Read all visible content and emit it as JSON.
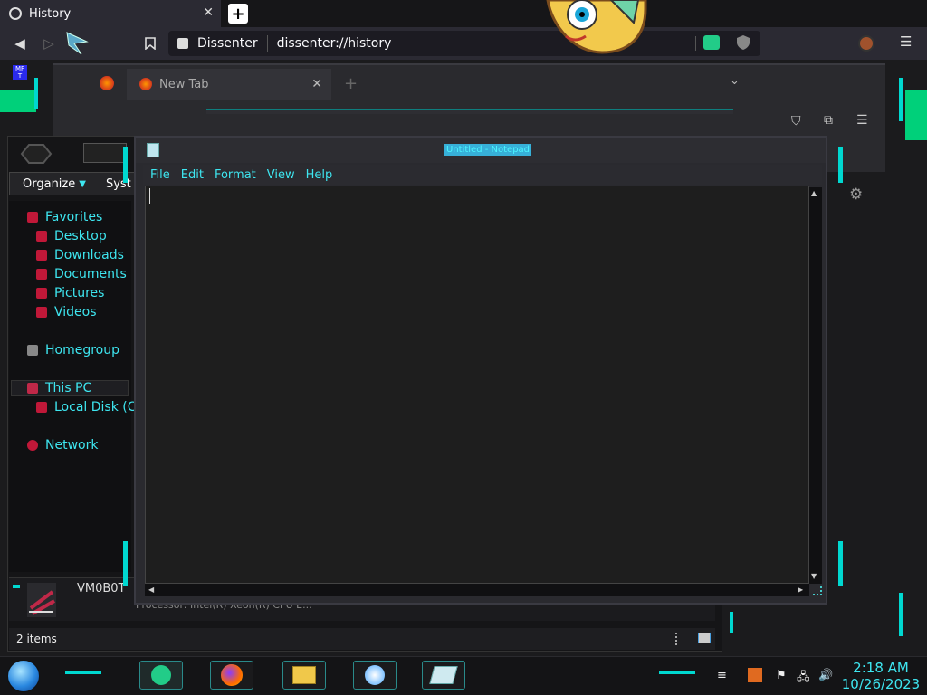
{
  "browser": {
    "tab_title": "History",
    "tab_close": "✕",
    "new_tab": "+",
    "site_name": "Dissenter",
    "url": "dissenter://history"
  },
  "back_browser": {
    "tab_title": "New Tab"
  },
  "explorer": {
    "toolbar_organize": "Organize",
    "toolbar_system": "Syst",
    "nav": {
      "favorites": "Favorites",
      "desktop": "Desktop",
      "downloads": "Downloads",
      "documents": "Documents",
      "pictures": "Pictures",
      "videos": "Videos",
      "homegroup": "Homegroup",
      "this_pc": "This PC",
      "local_disk": "Local Disk (C:",
      "network": "Network"
    },
    "computer_name": "VM0B0T",
    "processor_text": "Processor: Intel(R) Xeon(R) CPU E...",
    "status": "2 items"
  },
  "notepad": {
    "title": "Untitled - Notepad",
    "menu": [
      "File",
      "Edit",
      "Format",
      "View",
      "Help"
    ]
  },
  "taskbar": {
    "time": "2:18 AM",
    "date": "10/26/2023"
  }
}
